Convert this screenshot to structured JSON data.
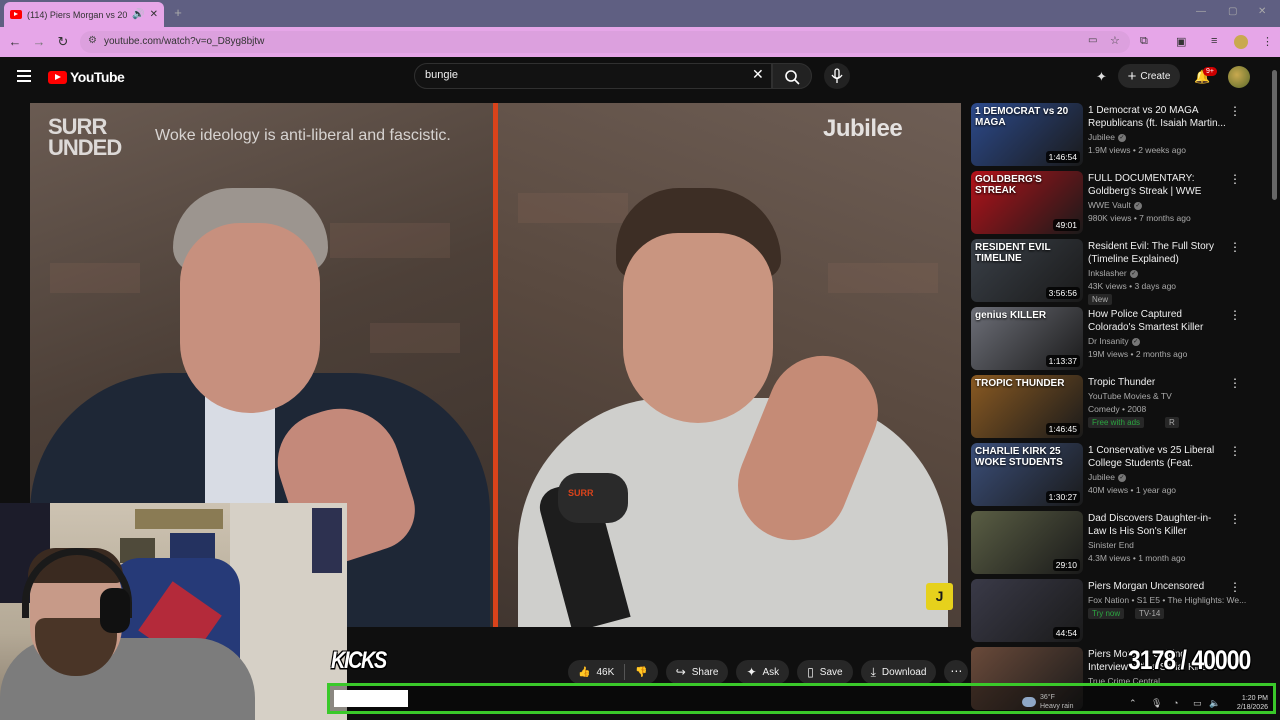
{
  "browser": {
    "tab_title": "(114) Piers Morgan vs 20 Wo",
    "tab_audio_icon": "speaker-icon",
    "url": "youtube.com/watch?v=o_D8yg8bjtw",
    "theme_color": "#e6a6e8"
  },
  "youtube": {
    "logo_text": "YouTube",
    "search_value": "bungie",
    "create_label": "Create",
    "notifications_badge": "9+"
  },
  "video": {
    "overlay_logo_left": "SURR UNDED",
    "overlay_caption": "Woke ideology is anti-liberal and fascistic.",
    "overlay_logo_right": "Jubilee",
    "corner_badge": "J",
    "mic_label": "SURR"
  },
  "actions": {
    "likes": "46K",
    "share": "Share",
    "ask": "Ask",
    "save": "Save",
    "download": "Download"
  },
  "recommendations": [
    {
      "thumb_text": "1 DEMOCRAT vs 20 MAGA",
      "duration": "1:46:54",
      "title": "1 Democrat vs 20 MAGA Republicans (ft. Isaiah Martin...",
      "channel": "Jubilee",
      "verified": true,
      "meta": "1.9M views • 2 weeks ago",
      "badges": [],
      "color": "#2c4a8c"
    },
    {
      "thumb_text": "GOLDBERG'S STREAK",
      "duration": "49:01",
      "title": "FULL DOCUMENTARY: Goldberg's Streak | WWE Untold",
      "channel": "WWE Vault",
      "verified": true,
      "meta": "980K views • 7 months ago",
      "badges": [],
      "color": "#b3121a"
    },
    {
      "thumb_text": "RESIDENT EVIL TIMELINE",
      "duration": "3:56:56",
      "title": "Resident Evil: The Full Story (Timeline Explained)",
      "channel": "Inkslasher",
      "verified": true,
      "meta": "43K views • 3 days ago",
      "badges": [
        {
          "text": "New",
          "green": false
        }
      ],
      "color": "#3a4048"
    },
    {
      "thumb_text": "genius KILLER",
      "duration": "1:13:37",
      "title": "How Police Captured Colorado's Smartest Killer",
      "channel": "Dr Insanity",
      "verified": true,
      "meta": "19M views • 2 months ago",
      "badges": [],
      "color": "#6d6f78"
    },
    {
      "thumb_text": "TROPIC THUNDER",
      "duration": "1:46:45",
      "title": "Tropic Thunder",
      "channel": "YouTube Movies & TV",
      "verified": false,
      "meta": "Comedy • 2008",
      "badges": [
        {
          "text": "Free with ads",
          "green": true
        },
        {
          "text": "R",
          "green": false
        }
      ],
      "color": "#8a5a22"
    },
    {
      "thumb_text": "CHARLIE KIRK 25 WOKE STUDENTS",
      "duration": "1:30:27",
      "title": "1 Conservative vs 25 Liberal College Students (Feat. Charli...",
      "channel": "Jubilee",
      "verified": true,
      "meta": "40M views • 1 year ago",
      "badges": [],
      "color": "#3b4f7a"
    },
    {
      "thumb_text": "",
      "duration": "29:10",
      "title": "Dad Discovers Daughter-in-Law Is His Son's Killer",
      "channel": "Sinister End",
      "verified": false,
      "meta": "4.3M views • 1 month ago",
      "badges": [],
      "color": "#5a5e44"
    },
    {
      "thumb_text": "",
      "duration": "44:54",
      "title": "Piers Morgan Uncensored",
      "channel": "Fox Nation • S1 E5 • The Highlights: We...",
      "verified": false,
      "meta": "",
      "badges": [
        {
          "text": "Try now",
          "green": true
        },
        {
          "text": "TV-14",
          "green": false
        }
      ],
      "color": "#3a3a48"
    },
    {
      "thumb_text": "",
      "duration": "",
      "title": "Piers Morgan: Chilling Interview with a Serial Killer & ...",
      "channel": "True Crime Central",
      "verified": false,
      "meta": "",
      "badges": [],
      "color": "#6a4a3a"
    }
  ],
  "overlay": {
    "goal_label": "KICKS",
    "goal_count": "3178 / 40000",
    "progress_fraction": 0.0795,
    "accent_color": "#3ac92a"
  },
  "taskbar": {
    "temperature": "36°F",
    "weather": "Heavy rain",
    "time": "1:20 PM",
    "date": "2/18/2026"
  }
}
